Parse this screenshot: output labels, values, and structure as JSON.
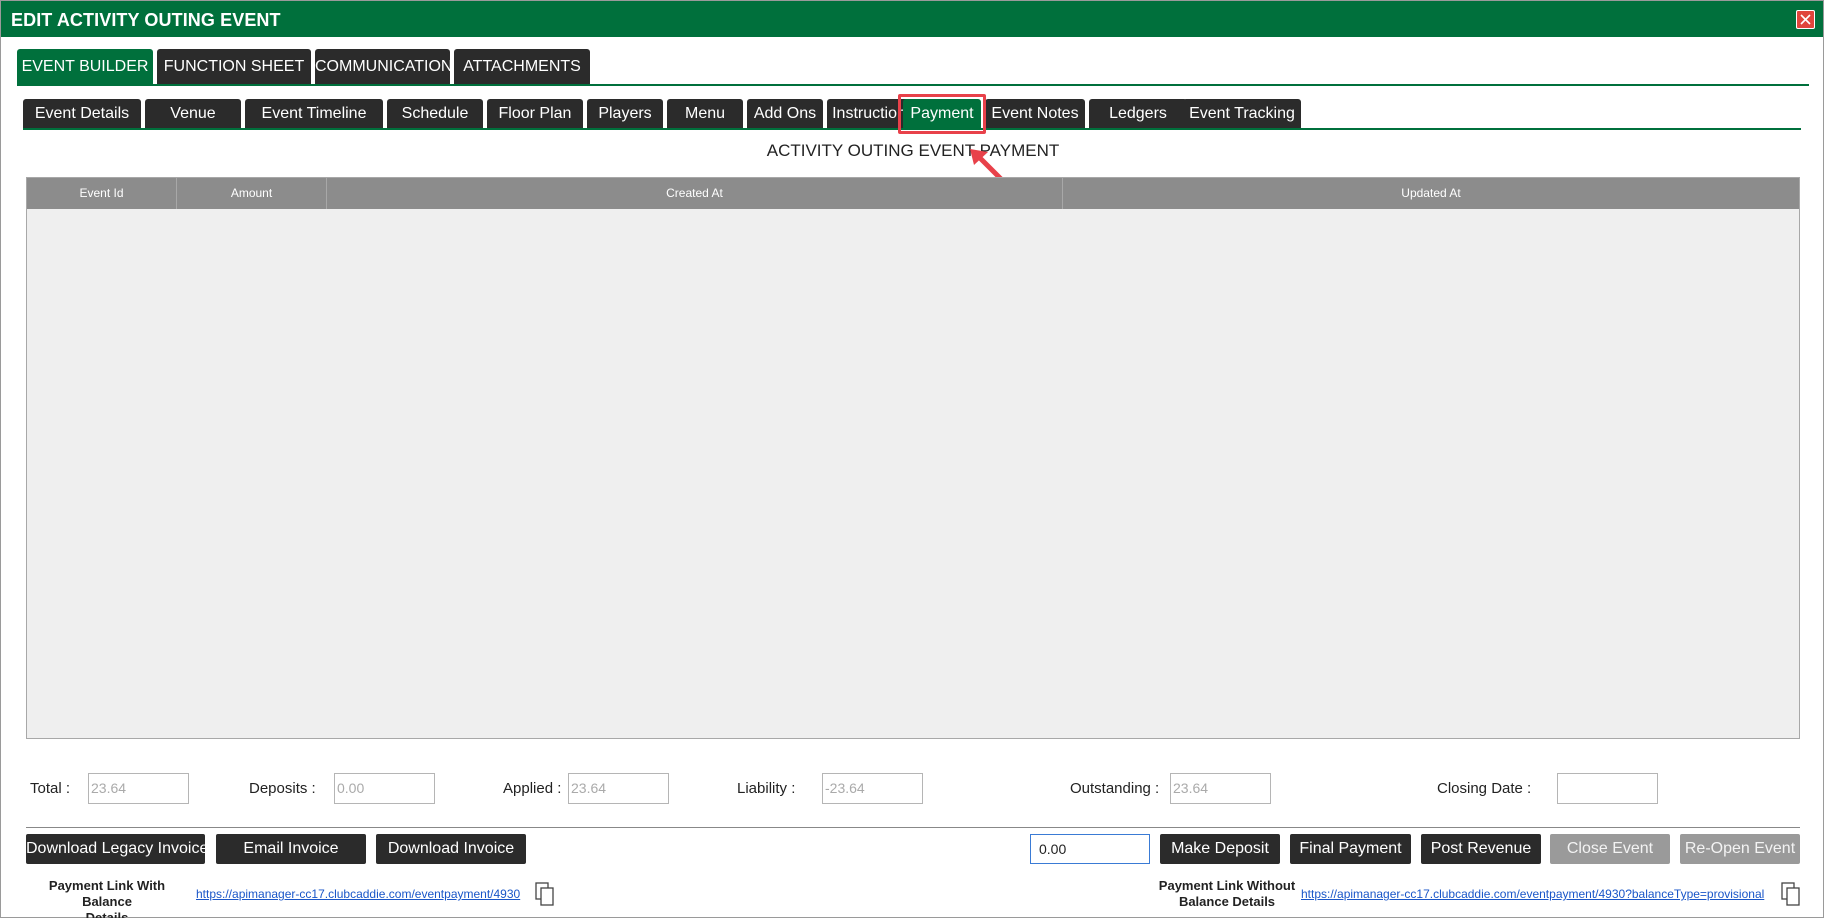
{
  "window": {
    "title": "EDIT ACTIVITY OUTING EVENT"
  },
  "main_tabs": [
    {
      "label": "EVENT BUILDER",
      "active": true
    },
    {
      "label": "FUNCTION SHEET",
      "active": false
    },
    {
      "label": "COMMUNICATION",
      "active": false
    },
    {
      "label": "ATTACHMENTS",
      "active": false
    }
  ],
  "sub_tabs": [
    {
      "label": "Event Details",
      "active": false
    },
    {
      "label": "Venue",
      "active": false
    },
    {
      "label": "Event Timeline",
      "active": false
    },
    {
      "label": "Schedule",
      "active": false
    },
    {
      "label": "Floor Plan",
      "active": false
    },
    {
      "label": "Players",
      "active": false
    },
    {
      "label": "Menu",
      "active": false
    },
    {
      "label": "Add Ons",
      "active": false
    },
    {
      "label": "Instructions",
      "active": false
    },
    {
      "label": "Payment",
      "active": true
    },
    {
      "label": "Event Notes",
      "active": false
    },
    {
      "label": "Ledgers",
      "active": false
    },
    {
      "label": "Event Tracking",
      "active": false
    }
  ],
  "section_title": "ACTIVITY OUTING EVENT PAYMENT",
  "grid": {
    "columns": [
      "Event Id",
      "Amount",
      "Created At",
      "Updated At"
    ],
    "rows": []
  },
  "summary": {
    "total_label": "Total :",
    "total_value": "23.64",
    "deposits_label": "Deposits :",
    "deposits_value": "0.00",
    "applied_label": "Applied :",
    "applied_value": "23.64",
    "liability_label": "Liability :",
    "liability_value": "-23.64",
    "outstanding_label": "Outstanding :",
    "outstanding_value": "23.64",
    "closing_date_label": "Closing Date :",
    "closing_date_value": ""
  },
  "actions": {
    "download_legacy_invoice": "Download Legacy Invoice",
    "email_invoice": "Email Invoice",
    "download_invoice": "Download Invoice",
    "deposit_amount": "0.00",
    "make_deposit": "Make Deposit",
    "final_payment": "Final Payment",
    "post_revenue": "Post Revenue",
    "close_event": "Close Event",
    "reopen_event": "Re-Open Event"
  },
  "links": {
    "with_balance_label_line1": "Payment Link With Balance",
    "with_balance_label_line2": "Details",
    "with_balance_url": "https://apimanager-cc17.clubcaddie.com/eventpayment/4930",
    "without_balance_label_line1": "Payment Link Without",
    "without_balance_label_line2": "Balance Details",
    "without_balance_url": "https://apimanager-cc17.clubcaddie.com/eventpayment/4930?balanceType=provisional"
  },
  "colors": {
    "brand_green": "#00703c",
    "tab_dark": "#2b2b2b",
    "highlight_red": "#e8414a",
    "disabled_gray": "#9a9a9a"
  }
}
